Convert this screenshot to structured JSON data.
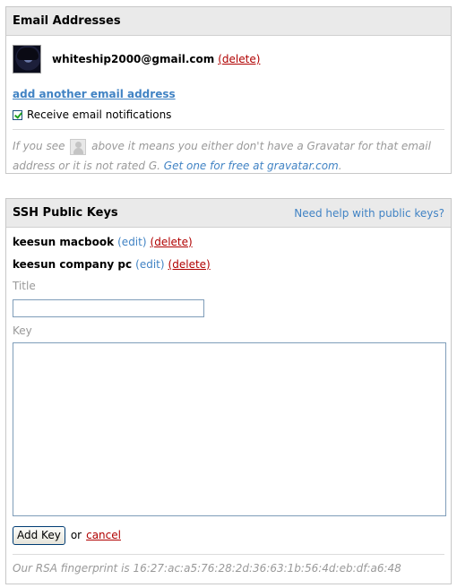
{
  "email_box": {
    "title": "Email Addresses",
    "email": "whiteship2000@gmail.com",
    "delete_label": "(delete)",
    "add_link": "add another email address",
    "notify_label": "Receive email notifications",
    "notify_checked": true,
    "note_part1": "If you see",
    "note_part2": "above it means you either don't have a Gravatar for that email address or it is not rated G.",
    "note_link": "Get one for free at gravatar.com",
    "note_end": "."
  },
  "ssh_box": {
    "title": "SSH Public Keys",
    "help_link": "Need help with public keys?",
    "keys": [
      {
        "name": "keesun macbook",
        "edit": "(edit)",
        "delete": "(delete)"
      },
      {
        "name": "keesun company pc",
        "edit": "(edit)",
        "delete": "(delete)"
      }
    ],
    "title_label": "Title",
    "title_value": "",
    "key_label": "Key",
    "key_value": "",
    "add_button": "Add Key",
    "or_text": "or",
    "cancel_link": "cancel",
    "fingerprint": "Our RSA fingerprint is 16:27:ac:a5:76:28:2d:36:63:1b:56:4d:eb:df:a6:48"
  },
  "colors": {
    "link": "#4183c4",
    "delete": "#b00000",
    "header_bg": "#eaeaea",
    "muted": "#999999"
  }
}
